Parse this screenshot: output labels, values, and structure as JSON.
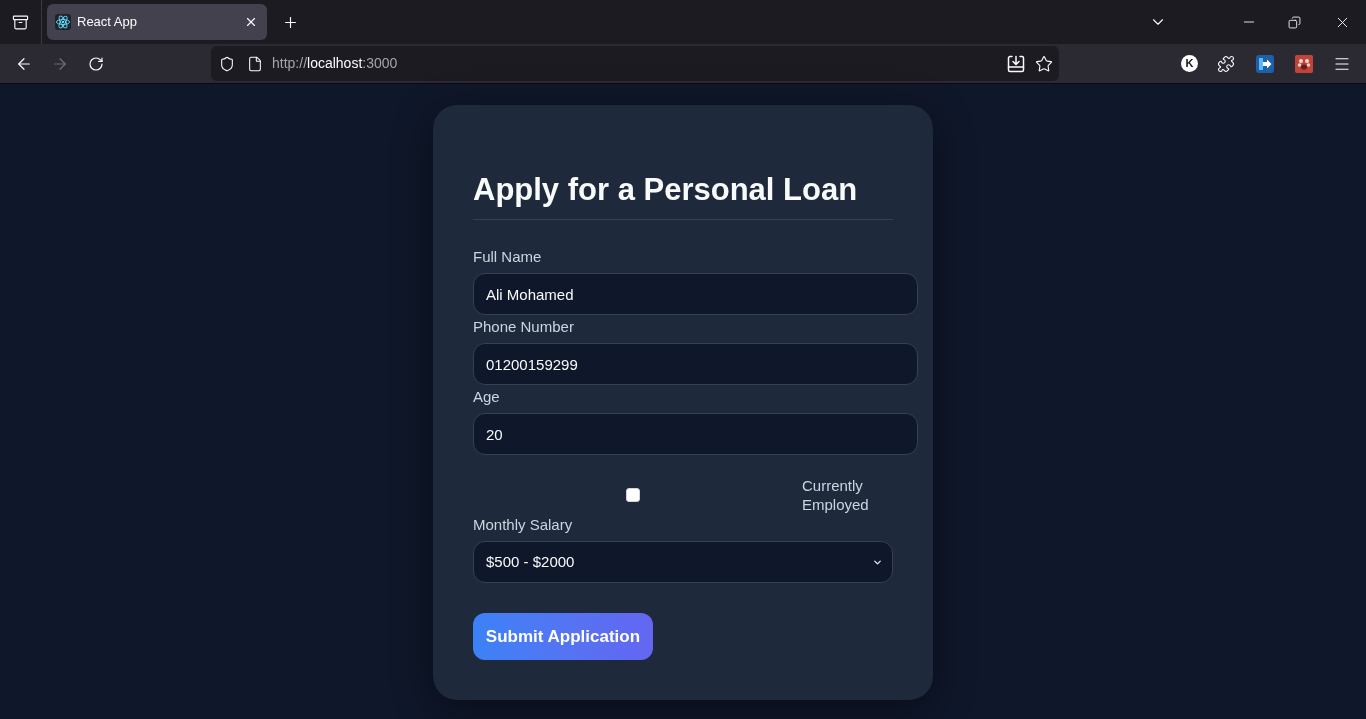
{
  "browser": {
    "tabs": [
      {
        "title": "React App",
        "selected": true
      }
    ],
    "forward_disabled": true,
    "url": {
      "scheme": "http://",
      "host": "localhost",
      "port": ":3000"
    },
    "extension_letter": "K"
  },
  "form": {
    "title": "Apply for a Personal Loan",
    "fields": [
      {
        "kind": "text",
        "label": "Full Name",
        "value": "Ali Mohamed"
      },
      {
        "kind": "text",
        "label": "Phone Number",
        "value": "01200159299"
      },
      {
        "kind": "text",
        "label": "Age",
        "value": "20"
      },
      {
        "kind": "checkbox",
        "label": "Currently Employed",
        "checked": false
      },
      {
        "kind": "select",
        "label": "Monthly Salary",
        "value": "$500 - $2000"
      }
    ],
    "submit": "Submit Application"
  }
}
